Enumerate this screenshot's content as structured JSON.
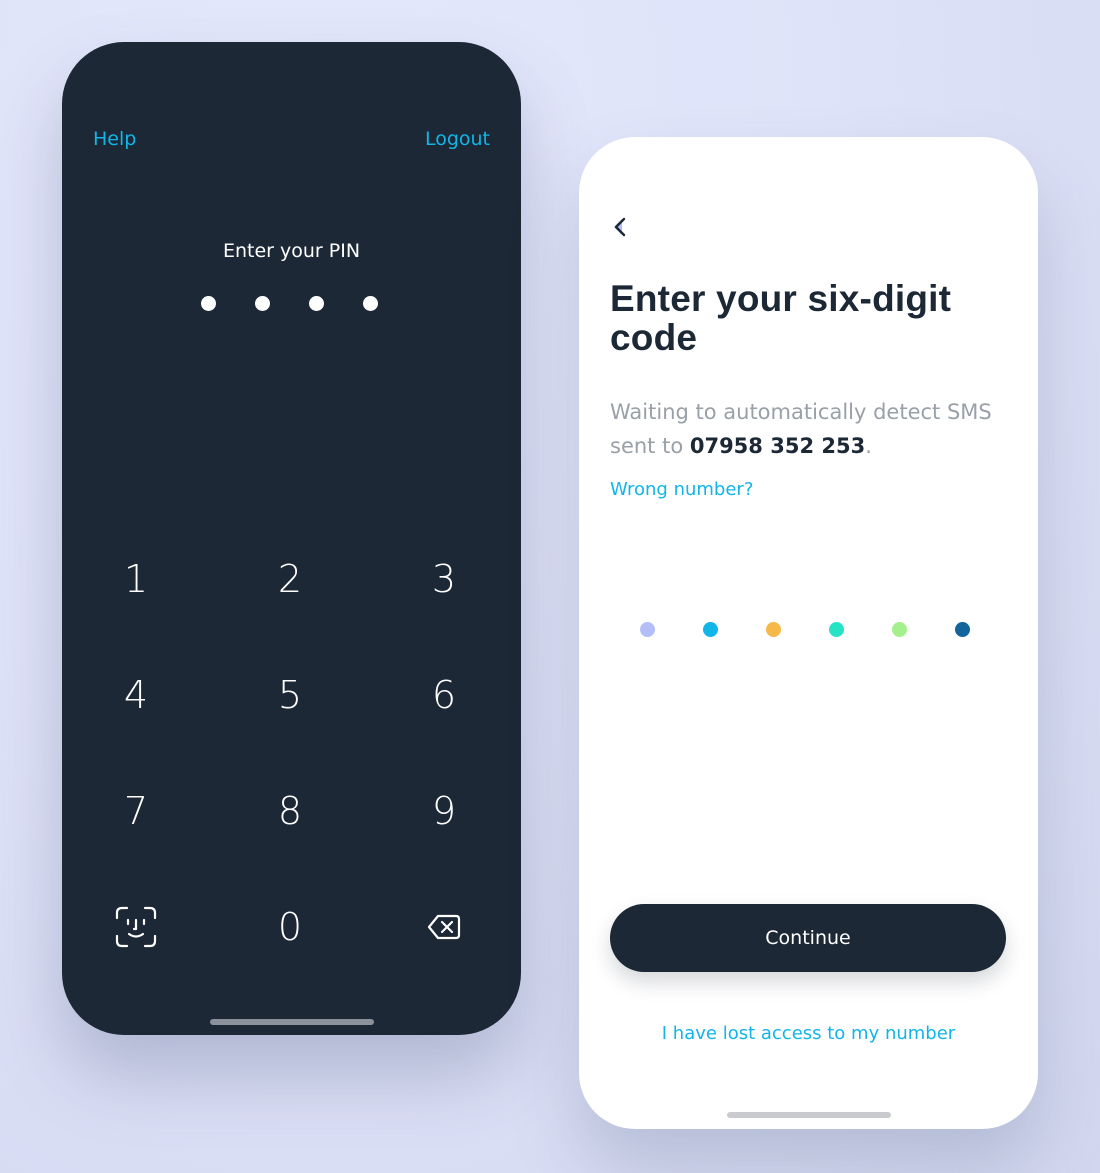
{
  "pin_screen": {
    "help_label": "Help",
    "logout_label": "Logout",
    "title": "Enter your PIN",
    "entered_digits": 4,
    "keypad": {
      "keys": [
        "1",
        "2",
        "3",
        "4",
        "5",
        "6",
        "7",
        "8",
        "9",
        "0"
      ],
      "face_id_icon": "face-id-icon",
      "backspace_icon": "backspace-icon"
    },
    "background_color": "#1c2836",
    "link_color": "#12b5e8"
  },
  "sms_screen": {
    "back_icon": "chevron-left-icon",
    "title": "Enter your six-digit code",
    "waiting_text": "Waiting to automatically detect SMS sent to ",
    "phone_number": "07958 352 253",
    "period": ".",
    "wrong_number_label": "Wrong number?",
    "code_dot_colors": [
      "#b3bdf7",
      "#12b5e8",
      "#f7b84a",
      "#27e3c6",
      "#a4f08c",
      "#11649c"
    ],
    "continue_label": "Continue",
    "lost_access_label": "I have lost access to my number",
    "accent_color": "#12b5e8"
  }
}
